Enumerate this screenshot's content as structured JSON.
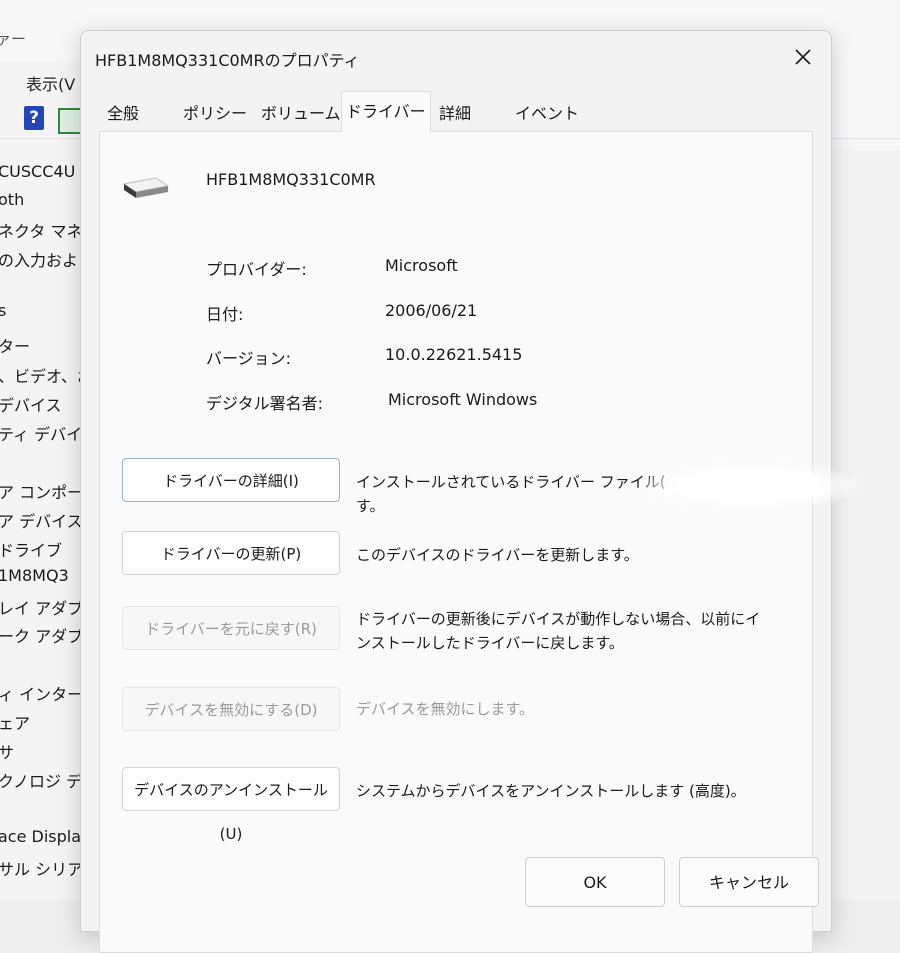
{
  "background_window": {
    "title_fragment": "ァー",
    "menu_view": "表示(V",
    "help_icon_glyph": "?",
    "tree_items": [
      "CUSCC4U",
      "oth",
      "ネクタ マネー",
      "の入力およ",
      "s",
      "ター",
      "、ビデオ、およ",
      "デバイス",
      "ティ デバイス",
      "ア コンポーネ",
      "ア デバイス",
      "ドライブ",
      "1M8MQ3",
      "レイ アダプター",
      "ーク アダプタ",
      "ィ インターフェ",
      "ェア",
      "サ",
      "クノロジ デバ",
      "ace Displa",
      "サル シリアル"
    ]
  },
  "dialog": {
    "title": "HFB1M8MQ331C0MRのプロパティ",
    "tabs": [
      "全般",
      "ポリシー",
      "ボリューム",
      "ドライバー",
      "詳細",
      "イベント"
    ],
    "active_tab": "ドライバー",
    "device_name": "HFB1M8MQ331C0MR",
    "info": {
      "provider_label": "プロバイダー:",
      "provider_value": "Microsoft",
      "date_label": "日付:",
      "date_value": "2006/06/21",
      "version_label": "バージョン:",
      "version_value": "10.0.22621.5415",
      "signer_label": "デジタル署名者:",
      "signer_value": "Microsoft Windows"
    },
    "actions": [
      {
        "label": "ドライバーの詳細(I)",
        "description": "インストールされているドライバー ファイル(",
        "description_line2": "す。"
      },
      {
        "label": "ドライバーの更新(P)",
        "description": "このデバイスのドライバーを更新します。"
      },
      {
        "label": "ドライバーを元に戻す(R)",
        "description": "ドライバーの更新後にデバイスが動作しない場合、以前にイ",
        "description_line2": "ンストールしたドライバーに戻します。"
      },
      {
        "label": "デバイスを無効にする(D)",
        "description": "デバイスを無効にします。"
      },
      {
        "label": "デバイスのアンインストール(U)",
        "description": "システムからデバイスをアンインストールします (高度)。"
      }
    ],
    "ok_label": "OK",
    "cancel_label": "キャンセル"
  }
}
